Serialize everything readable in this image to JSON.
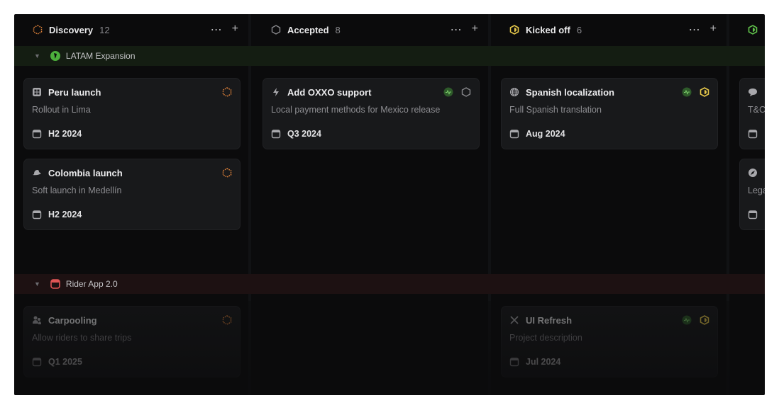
{
  "columns": [
    {
      "title": "Discovery",
      "count": "12",
      "status_color": "#e0823a",
      "icon": "hexagon-dotted-icon"
    },
    {
      "title": "Accepted",
      "count": "8",
      "status_color": "#8a8a8e",
      "icon": "hexagon-outline-icon"
    },
    {
      "title": "Kicked off",
      "count": "6",
      "status_color": "#e6c84a",
      "icon": "hexagon-half-icon"
    },
    {
      "title": "",
      "count": "",
      "status_color": "#5fbf4a",
      "icon": "hexagon-half-icon"
    }
  ],
  "groups": [
    {
      "label": "LATAM Expansion",
      "color": "#4caf3c",
      "icon": "south-america-icon"
    },
    {
      "label": "Rider App 2.0",
      "color": "#e05555",
      "icon": "app-icon"
    }
  ],
  "cards": {
    "peru": {
      "title": "Peru launch",
      "desc": "Rollout in Lima",
      "date": "H2 2024",
      "icon": "grid-icon"
    },
    "colombia": {
      "title": "Colombia launch",
      "desc": "Soft launch in Medellín",
      "date": "H2 2024",
      "icon": "hat-icon"
    },
    "oxxo": {
      "title": "Add OXXO support",
      "desc": "Local payment methods for Mexico release",
      "date": "Q3 2024",
      "icon": "bolt-icon"
    },
    "spanish": {
      "title": "Spanish localization",
      "desc": "Full Spanish translation",
      "date": "Aug 2024",
      "icon": "globe-icon"
    },
    "tc": {
      "desc": "T&C"
    },
    "legal": {
      "desc": "Lega"
    },
    "carpool": {
      "title": "Carpooling",
      "desc": "Allow riders to share trips",
      "date": "Q1 2025",
      "icon": "users-icon"
    },
    "uirefresh": {
      "title": "UI Refresh",
      "desc": "Project description",
      "date": "Jul 2024",
      "icon": "tools-icon"
    }
  },
  "colors": {
    "bg": "#0b0b0c",
    "card": "#18191b",
    "health_green": "#2e5a2a"
  }
}
